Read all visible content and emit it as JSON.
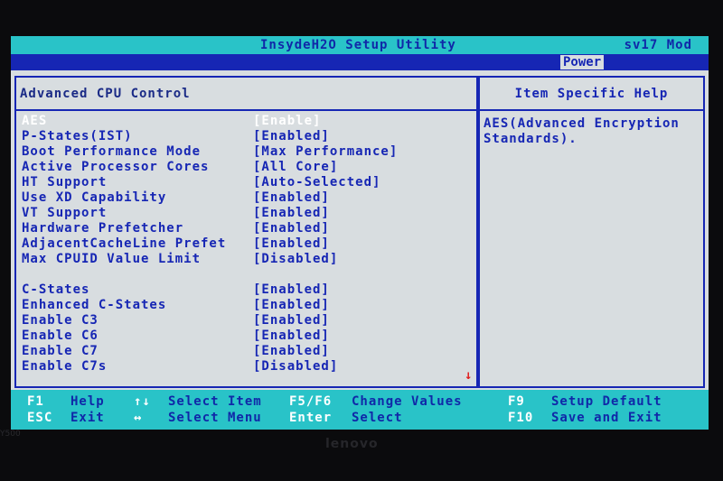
{
  "header": {
    "title": "InsydeH2O Setup Utility",
    "model": "sv17 Mod",
    "active_tab": "Power"
  },
  "left_pane": {
    "section_title": "Advanced CPU Control",
    "settings": [
      {
        "label": "AES",
        "value": "[Enable]",
        "selected": true
      },
      {
        "label": "P-States(IST)",
        "value": "[Enabled]"
      },
      {
        "label": "Boot Performance Mode",
        "value": "[Max Performance]"
      },
      {
        "label": "Active Processor Cores",
        "value": "[All Core]"
      },
      {
        "label": "HT Support",
        "value": "[Auto-Selected]"
      },
      {
        "label": "Use XD Capability",
        "value": "[Enabled]"
      },
      {
        "label": "VT Support",
        "value": "[Enabled]"
      },
      {
        "label": "Hardware Prefetcher",
        "value": "[Enabled]"
      },
      {
        "label": "AdjacentCacheLine Prefet",
        "value": "[Enabled]"
      },
      {
        "label": "Max CPUID Value Limit",
        "value": "[Disabled]"
      },
      {
        "label": "C-States",
        "value": "[Enabled]"
      },
      {
        "label": "Enhanced C-States",
        "value": "[Enabled]"
      },
      {
        "label": "Enable C3",
        "value": "[Enabled]"
      },
      {
        "label": "Enable C6",
        "value": "[Enabled]"
      },
      {
        "label": "Enable C7",
        "value": "[Enabled]"
      },
      {
        "label": "Enable C7s",
        "value": "[Disabled]"
      }
    ],
    "scroll_indicator": "↓"
  },
  "right_pane": {
    "title": "Item Specific Help",
    "help_text": "AES(Advanced Encryption Standards)."
  },
  "footer": {
    "f1_key": "F1",
    "f1_desc": "Help",
    "esc_key": "ESC",
    "esc_desc": "Exit",
    "updown_key": "↑↓",
    "updown_desc": "Select Item",
    "leftright_key": "↔",
    "leftright_desc": "Select Menu",
    "f5f6_key": "F5/F6",
    "f5f6_desc": "Change Values",
    "enter_key": "Enter",
    "enter_desc": "Select",
    "f9_key": "F9",
    "f9_desc": "Setup Default",
    "f10_key": "F10",
    "f10_desc": "Save and Exit"
  },
  "bezel": {
    "brand": "lenovo",
    "corner_label": "Y500"
  },
  "colors": {
    "background": "#d8dde0",
    "accent_blue": "#1626b4",
    "title_cyan": "#29c3c8",
    "selected_text": "#ffffff",
    "scroll_arrow": "#e02020"
  }
}
